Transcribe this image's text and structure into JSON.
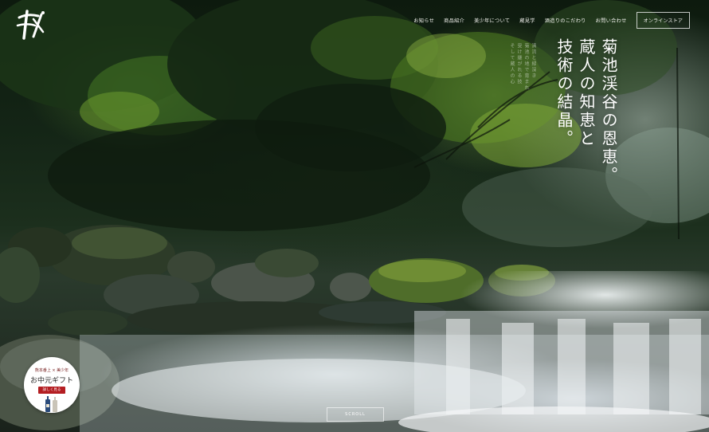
{
  "nav": {
    "items": [
      "お知らせ",
      "商品紹介",
      "美少年について",
      "蔵見学",
      "酒造りのこだわり",
      "お問い合わせ"
    ],
    "store_label": "オンラインストア"
  },
  "hero": {
    "headline_columns": [
      "菊池渓谷の恩恵。",
      "蔵人の知恵と",
      "技術の結晶。"
    ],
    "subtext_columns": [
      "清流と緑深き",
      "菊池の地で育まれ",
      "受け継がれる技",
      "そして蔵人の心"
    ]
  },
  "gift": {
    "top_line": "熊本番上 × 美少年",
    "title": "お中元ギフト",
    "button_label": "詳しく見る"
  },
  "scroll_label": "SCROLL",
  "colors": {
    "accent": "#b41e22",
    "text_light": "#ffffff"
  },
  "icons": {
    "logo": "brush-calligraphy-logo"
  }
}
